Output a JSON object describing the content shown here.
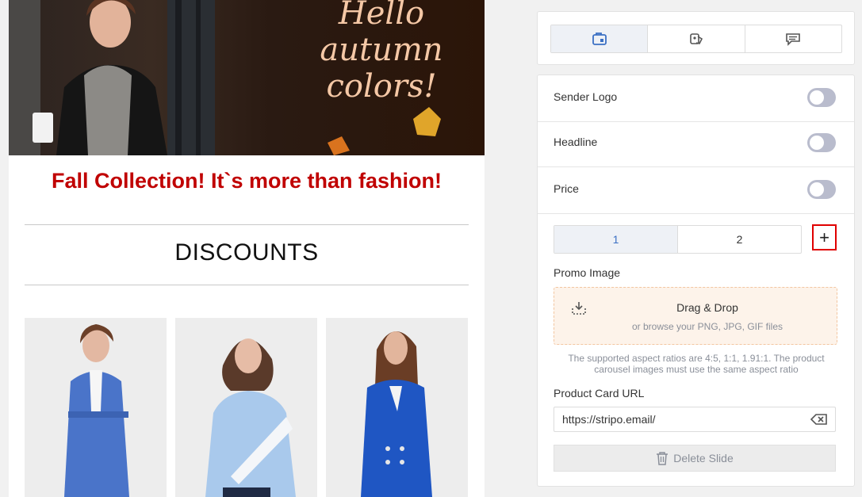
{
  "email": {
    "banner_text": [
      "Hello",
      "autumn",
      "colors!"
    ],
    "headline": "Fall Collection! It`s more than fashion!",
    "section_title": "DISCOUNTS",
    "products": [
      {
        "image": "woman-blue-coat",
        "color": "#4a74c9"
      },
      {
        "image": "woman-light-blue-sweater",
        "color": "#a9c9ec"
      },
      {
        "image": "woman-blue-blazer",
        "color": "#1f56c3"
      }
    ]
  },
  "panel": {
    "tabs": [
      {
        "icon": "content-card-icon",
        "active": true
      },
      {
        "icon": "settings-tag-icon",
        "active": false
      },
      {
        "icon": "message-icon",
        "active": false
      }
    ],
    "toggles": [
      {
        "label": "Sender Logo",
        "on": false
      },
      {
        "label": "Headline",
        "on": false
      },
      {
        "label": "Price",
        "on": false
      }
    ],
    "slides": [
      "1",
      "2"
    ],
    "active_slide": "1",
    "add_slide_label": "+",
    "promo_image_label": "Promo Image",
    "dropzone": {
      "title": "Drag & Drop",
      "subtitle": "or browse your PNG, JPG, GIF files"
    },
    "hint": "The supported aspect ratios are 4:5, 1:1, 1.91:1. The product carousel images must use the same aspect ratio",
    "url_label": "Product Card URL",
    "url_value": "https://stripo.email/",
    "delete_label": "Delete Slide"
  },
  "colors": {
    "accent": "#3b70c4",
    "headline_red": "#c00000",
    "highlight_border": "#e00000",
    "dropzone_bg": "#fdf3ea"
  }
}
